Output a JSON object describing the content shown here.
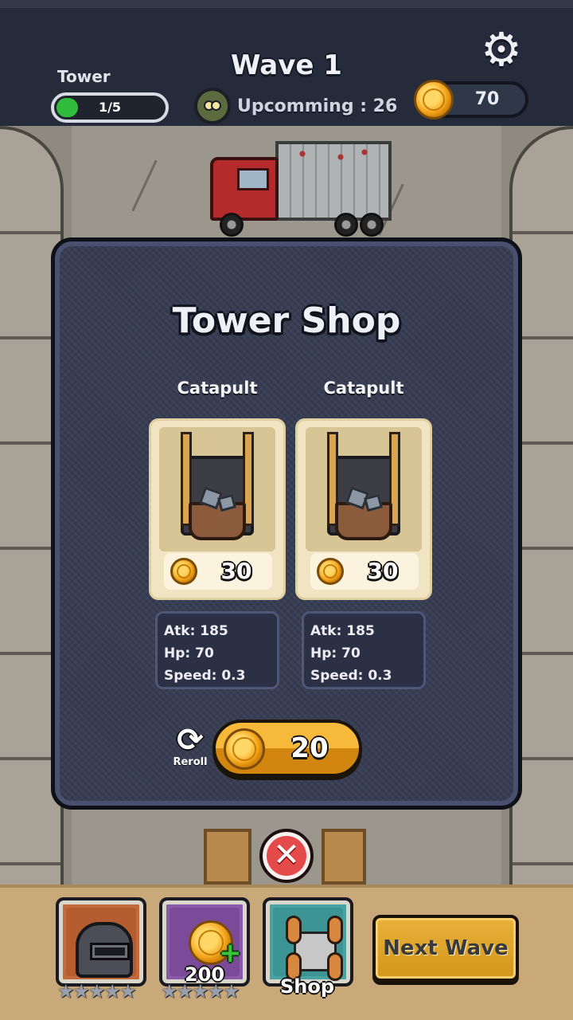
{
  "hud": {
    "tower_label": "Tower",
    "tower_progress_text": "1/5",
    "tower_progress_fraction": 0.2,
    "wave_title": "Wave 1",
    "upcoming_text": "Upcomming : 26",
    "coins": "70",
    "settings_icon": "gear-icon",
    "zombie_icon": "zombie-head-icon"
  },
  "shop": {
    "title": "Tower Shop",
    "items": [
      {
        "name": "Catapult",
        "price": "30",
        "stats": [
          "Atk: 185",
          "Hp: 70",
          "Speed: 0.3"
        ]
      },
      {
        "name": "Catapult",
        "price": "30",
        "stats": [
          "Atk: 185",
          "Hp: 70",
          "Speed: 0.3"
        ]
      }
    ],
    "reroll_label": "Reroll",
    "reroll_cost": "20",
    "reroll_icon": "refresh-icon",
    "close_icon": "close-icon"
  },
  "bottom_bar": {
    "hero": {
      "icon": "helmet-icon",
      "stars": "★★★★★"
    },
    "coin_bonus": {
      "icon": "coin-plus-icon",
      "value": "200",
      "stars": "★★★★★"
    },
    "shop": {
      "icon": "catapult-shop-icon",
      "label": "Shop"
    },
    "next_wave_label": "Next Wave"
  },
  "colors": {
    "hud_bg": "#252b3a",
    "modal_bg": "#363c52",
    "card_bg": "#f1e4c3",
    "coin": "#f3a51b",
    "progress_green": "#2fbd3b",
    "close_red": "#e44a4a",
    "next_wave_gold": "#e8b13a"
  }
}
